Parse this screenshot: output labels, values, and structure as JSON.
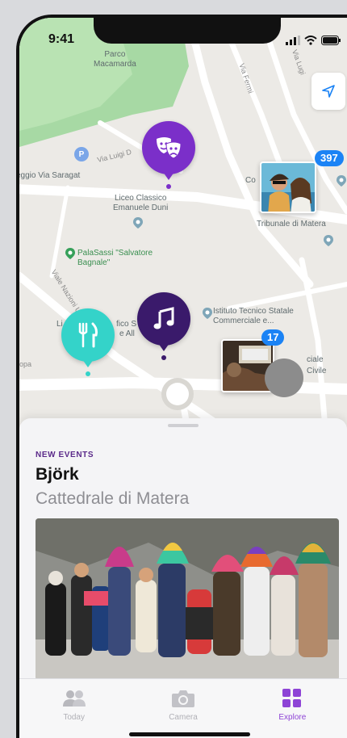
{
  "status": {
    "time": "9:41"
  },
  "map": {
    "park_label": "Parco\nMacamarda",
    "poi_liceo": "Liceo Classico\nEmanuele Duni",
    "poi_palasassi": "PalaSassi \"Salvatore\nBagnale\"",
    "poi_istituto": "Istituto Tecnico Statale\nCommerciale e...",
    "poi_tribunale": "Tribunale di Matera",
    "poi_saragat": "eggio Via Saragat",
    "poi_co": "Co",
    "poi_liceo2": "Li",
    "poi_fico": "fico S",
    "poi_alle": "e All",
    "poi_ciale": "ciale",
    "poi_civile": "Civile",
    "street_luigi": "Via Luigi D",
    "street_nazioni": "Viale Nazioni Unite",
    "street_fermi": "Via Fermi",
    "street_gallo": "Via Lugi",
    "street_opa": "opa",
    "cluster_count_top": "397",
    "cluster_count_bottom": "17",
    "colors": {
      "purple_pin": "#7b2fc9",
      "dark_purple_pin": "#3a1a6b",
      "teal_pin": "#34d3c9",
      "badge_blue": "#1b83f5"
    }
  },
  "sheet": {
    "eyebrow": "NEW EVENTS",
    "title": "Björk",
    "venue": "Cattedrale di Matera"
  },
  "tabs": [
    {
      "label": "Today",
      "icon": "people-icon"
    },
    {
      "label": "Camera",
      "icon": "camera-icon"
    },
    {
      "label": "Explore",
      "icon": "grid-icon"
    }
  ]
}
